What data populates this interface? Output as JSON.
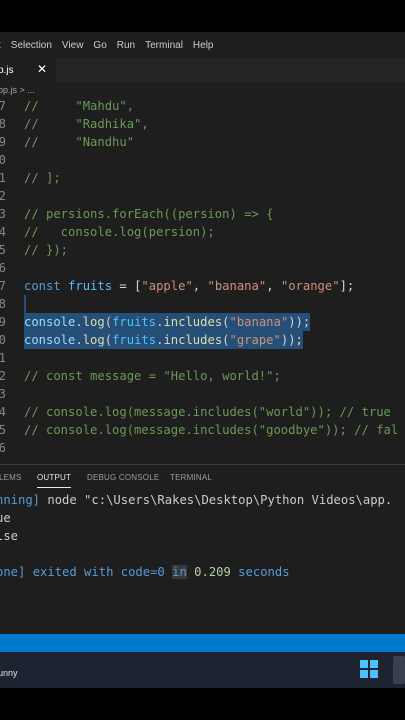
{
  "menubar": {
    "items": [
      "t",
      "Selection",
      "View",
      "Go",
      "Run",
      "Terminal",
      "Help"
    ]
  },
  "tab": {
    "label": "p.js",
    "close": "✕"
  },
  "breadcrumb": "op.js > ...",
  "editor": {
    "lines": [
      {
        "n": "7"
      },
      {
        "n": "8"
      },
      {
        "n": "9"
      },
      {
        "n": "0"
      },
      {
        "n": "1"
      },
      {
        "n": "2"
      },
      {
        "n": "3"
      },
      {
        "n": "4"
      },
      {
        "n": "5"
      },
      {
        "n": "6"
      },
      {
        "n": "7"
      },
      {
        "n": "8"
      },
      {
        "n": "9"
      },
      {
        "n": "0"
      },
      {
        "n": "1"
      },
      {
        "n": "2"
      },
      {
        "n": "3"
      },
      {
        "n": "4"
      },
      {
        "n": "5"
      },
      {
        "n": "6"
      }
    ],
    "code": {
      "l1": "//     \"Mahdu\",",
      "l2": "//     \"Radhika\",",
      "l3": "//     \"Nandhu\"",
      "l5": "// ];",
      "l7": "// persions.forEach((persion) => {",
      "l8": "//   console.log(persion);",
      "l9": "// });",
      "l11_kw": "const",
      "l11_var": "fruits",
      "l11_eq": " = [",
      "l11_s1": "\"apple\"",
      "l11_c1": ", ",
      "l11_s2": "\"banana\"",
      "l11_c2": ", ",
      "l11_s3": "\"orange\"",
      "l11_end": "];",
      "l13_obj": "console",
      "l13_dot": ".",
      "l13_fn": "log",
      "l13_p1": "(",
      "l13_var": "fruits",
      "l13_dot2": ".",
      "l13_fn2": "includes",
      "l13_p2": "(",
      "l13_str": "\"banana\"",
      "l13_end": "));",
      "l14_obj": "console",
      "l14_dot": ".",
      "l14_fn": "log",
      "l14_p1": "(",
      "l14_var": "fruits",
      "l14_dot2": ".",
      "l14_fn2": "includes",
      "l14_p2": "(",
      "l14_str": "\"grape\"",
      "l14_end": "));",
      "l16": "// const message = \"Hello, world!\";",
      "l18": "// console.log(message.includes(\"world\")); // true",
      "l19": "// console.log(message.includes(\"goodbye\")); // fal"
    }
  },
  "panel": {
    "tabs": [
      "LEMS",
      "OUTPUT",
      "DEBUG CONSOLE",
      "TERMINAL"
    ],
    "output": {
      "run_prefix": "nning]",
      "run_cmd": " node \"c:\\Users\\Rakes\\Desktop\\Python Videos\\app.",
      "line2": "ue",
      "line3": "lse",
      "done_prefix": "one]",
      "done_a": " exited with ",
      "done_code": "code=0",
      "done_b": " ",
      "done_in": "in",
      "done_c": " ",
      "done_num": "0.209",
      "done_d": " seconds"
    }
  },
  "taskbar": {
    "label": "unny"
  },
  "colors": {
    "accent": "#007acc",
    "selection": "#264f78",
    "editor_bg": "#1e1e1e"
  }
}
